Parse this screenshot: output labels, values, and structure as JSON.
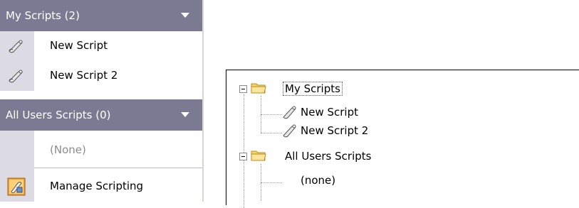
{
  "panel": {
    "sections": [
      {
        "title": "My Scripts (2)",
        "items": [
          "New Script",
          "New Script 2"
        ]
      },
      {
        "title": "All Users Scripts (0)",
        "empty_text": "(None)"
      }
    ],
    "manage_label": "Manage Scripting"
  },
  "tree": {
    "nodes": [
      {
        "label": "My Scripts",
        "children": [
          "New Script",
          "New Script 2"
        ]
      },
      {
        "label": "All Users Scripts",
        "children": [
          "(none)"
        ]
      }
    ]
  },
  "colors": {
    "header_bg": "#7c7a93",
    "gutter_bg": "#dcdae2",
    "folder": "#f4d56b"
  }
}
